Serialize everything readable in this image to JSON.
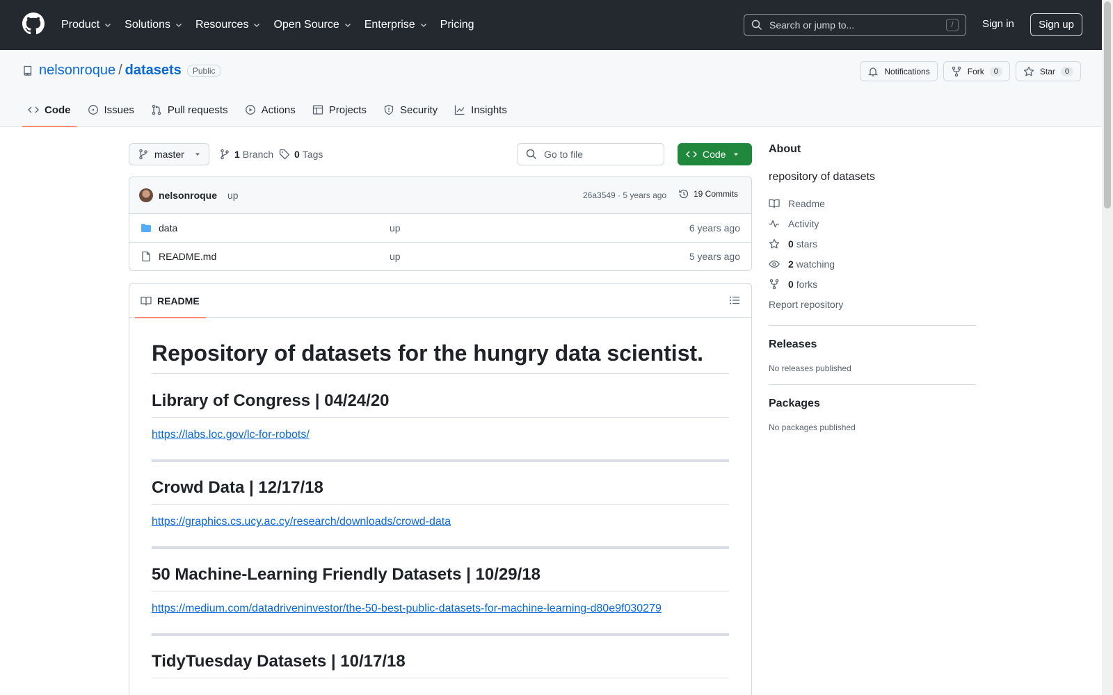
{
  "header": {
    "nav": [
      "Product",
      "Solutions",
      "Resources",
      "Open Source",
      "Enterprise",
      "Pricing"
    ],
    "search_placeholder": "Search or jump to...",
    "search_shortcut": "/",
    "sign_in": "Sign in",
    "sign_up": "Sign up"
  },
  "repo": {
    "owner": "nelsonroque",
    "separator": "/",
    "name": "datasets",
    "visibility": "Public",
    "actions": {
      "notifications": "Notifications",
      "fork": "Fork",
      "fork_count": "0",
      "star": "Star",
      "star_count": "0"
    },
    "tabs": [
      "Code",
      "Issues",
      "Pull requests",
      "Actions",
      "Projects",
      "Security",
      "Insights"
    ],
    "active_tab": "Code"
  },
  "toolbar": {
    "branch": "master",
    "branch_count": "1",
    "branch_label": "Branch",
    "tag_count": "0",
    "tag_label": "Tags",
    "goto_placeholder": "Go to file",
    "code_button": "Code"
  },
  "commit": {
    "author": "nelsonroque",
    "message": "up",
    "hash_and_age": "26a3549 · 5 years ago",
    "commits_label": "19 Commits"
  },
  "files": [
    {
      "name": "data",
      "type": "folder",
      "message": "up",
      "age": "6 years ago"
    },
    {
      "name": "README.md",
      "type": "file",
      "message": "up",
      "age": "5 years ago"
    }
  ],
  "readme": {
    "tab_label": "README",
    "title": "Repository of datasets for the hungry data scientist.",
    "sections": [
      {
        "heading": "Library of Congress | 04/24/20",
        "link": "https://labs.loc.gov/lc-for-robots/"
      },
      {
        "heading": "Crowd Data | 12/17/18",
        "link": "https://graphics.cs.ucy.ac.cy/research/downloads/crowd-data"
      },
      {
        "heading": "50 Machine-Learning Friendly Datasets | 10/29/18",
        "link": "https://medium.com/datadriveninvestor/the-50-best-public-datasets-for-machine-learning-d80e9f030279"
      },
      {
        "heading": "TidyTuesday Datasets | 10/17/18",
        "link": ""
      }
    ]
  },
  "sidebar": {
    "about_heading": "About",
    "description": "repository of datasets",
    "readme": "Readme",
    "activity": "Activity",
    "stars_count": "0",
    "stars_label": "stars",
    "watching_count": "2",
    "watching_label": "watching",
    "forks_count": "0",
    "forks_label": "forks",
    "report": "Report repository",
    "releases_heading": "Releases",
    "releases_empty": "No releases published",
    "packages_heading": "Packages",
    "packages_empty": "No packages published"
  },
  "colors": {
    "header_bg": "#24292f",
    "link": "#0969da",
    "code_button": "#1f883d",
    "active_tab_underline": "#fd8c73"
  }
}
